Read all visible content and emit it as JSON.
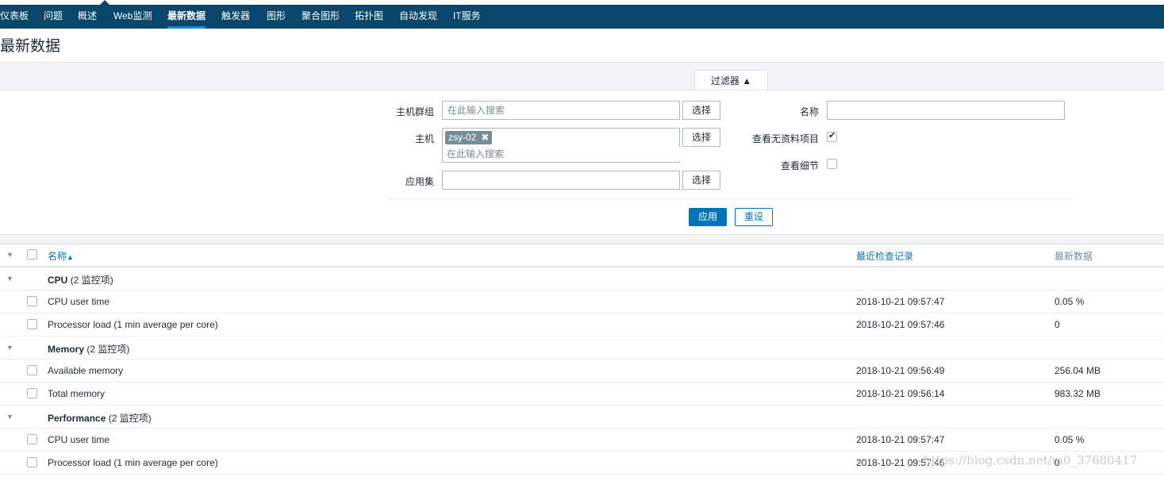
{
  "nav": {
    "items": [
      {
        "label": "仪表板"
      },
      {
        "label": "问题"
      },
      {
        "label": "概述"
      },
      {
        "label": "Web监测"
      },
      {
        "label": "最新数据"
      },
      {
        "label": "触发器"
      },
      {
        "label": "图形"
      },
      {
        "label": "聚合图形"
      },
      {
        "label": "拓扑图"
      },
      {
        "label": "自动发现"
      },
      {
        "label": "IT服务"
      }
    ],
    "active": "最新数据"
  },
  "page_title": "最新数据",
  "filter": {
    "tab_label": "过滤器 ▲",
    "host_group_label": "主机群组",
    "host_group_placeholder": "在此输入搜索",
    "host_label": "主机",
    "host_chip": "zsy-02",
    "host_placeholder": "在此输入搜索",
    "application_label": "应用集",
    "application_value": "",
    "select_label": "选择",
    "name_label": "名称",
    "name_value": "",
    "show_without_data_label": "查看无资料项目",
    "show_without_data": true,
    "show_details_label": "查看细节",
    "show_details": false,
    "apply_label": "应用",
    "reset_label": "重设"
  },
  "table": {
    "headers": {
      "name": "名称",
      "name_sort": "▲",
      "last_check": "最近检查记录",
      "last_value": "最新数据"
    },
    "groups": [
      {
        "name": "CPU",
        "count": "(2 监控项)",
        "items": [
          {
            "name": "CPU user time",
            "last_check": "2018-10-21 09:57:47",
            "last_value": "0.05 %"
          },
          {
            "name": "Processor load (1 min average per core)",
            "last_check": "2018-10-21 09:57:46",
            "last_value": "0"
          }
        ]
      },
      {
        "name": "Memory",
        "count": "(2 监控项)",
        "items": [
          {
            "name": "Available memory",
            "last_check": "2018-10-21 09:56:49",
            "last_value": "256.04 MB"
          },
          {
            "name": "Total memory",
            "last_check": "2018-10-21 09:56:14",
            "last_value": "983.32 MB"
          }
        ]
      },
      {
        "name": "Performance",
        "count": "(2 监控项)",
        "items": [
          {
            "name": "CPU user time",
            "last_check": "2018-10-21 09:57:47",
            "last_value": "0.05 %"
          },
          {
            "name": "Processor load (1 min average per core)",
            "last_check": "2018-10-21 09:57:46",
            "last_value": "0"
          }
        ]
      }
    ]
  },
  "watermark": "https://blog.csdn.net/m0_37680417",
  "colors": {
    "nav_bg": "#0a466a",
    "accent": "#0275b8",
    "gray_band": "#f1f3f4"
  }
}
